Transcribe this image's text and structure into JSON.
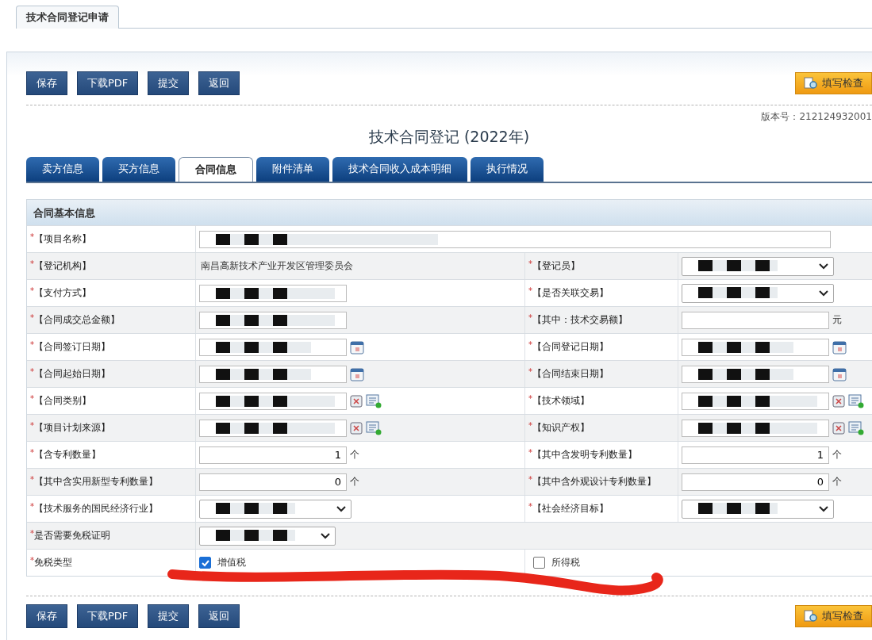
{
  "page_tab": {
    "label": "技术合同登记申请"
  },
  "toolbar": {
    "buttons": [
      "保存",
      "下载PDF",
      "提交",
      "返回"
    ],
    "check_button": "填写检查"
  },
  "bottom_toolbar": {
    "buttons": [
      "保存",
      "下载PDF",
      "提交",
      "返回"
    ],
    "check_button": "填写检查"
  },
  "version": "版本号：212124932001",
  "title": "技术合同登记 (2022年)",
  "tabs": [
    {
      "label": "卖方信息",
      "selected": false
    },
    {
      "label": "买方信息",
      "selected": false
    },
    {
      "label": "合同信息",
      "selected": true
    },
    {
      "label": "附件清单",
      "selected": false
    },
    {
      "label": "技术合同收入成本明细",
      "selected": false
    },
    {
      "label": "执行情况",
      "selected": false
    }
  ],
  "section": {
    "title": "合同基本信息",
    "rows": [
      {
        "kind": "wide",
        "fields": [
          {
            "marker": "*",
            "label": "【项目名称】",
            "kind": "input",
            "redacted": true
          }
        ]
      },
      {
        "kind": "pair",
        "fields": [
          {
            "marker": "*",
            "label": "【登记机构】",
            "kind": "text",
            "value": "南昌高新技术产业开发区管理委员会"
          },
          {
            "marker": "*",
            "label": "【登记员】",
            "kind": "select",
            "redacted": true
          }
        ]
      },
      {
        "kind": "pair",
        "fields": [
          {
            "marker": "*",
            "label": "【支付方式】",
            "kind": "input",
            "redacted": true
          },
          {
            "marker": "*",
            "label": "【是否关联交易】",
            "kind": "select",
            "redacted": true
          }
        ]
      },
      {
        "kind": "pair",
        "fields": [
          {
            "marker": "*",
            "label": "【合同成交总金额】",
            "kind": "input",
            "redacted": true
          },
          {
            "marker": "*",
            "label": "【其中：技术交易额】",
            "kind": "input",
            "unit": "元"
          }
        ]
      },
      {
        "kind": "pair",
        "fields": [
          {
            "marker": "*",
            "label": "【合同签订日期】",
            "kind": "date",
            "redacted": true
          },
          {
            "marker": "*",
            "label": "【合同登记日期】",
            "kind": "date",
            "redacted": true
          }
        ]
      },
      {
        "kind": "pair",
        "fields": [
          {
            "marker": "*",
            "label": "【合同起始日期】",
            "kind": "date",
            "redacted": true
          },
          {
            "marker": "*",
            "label": "【合同结束日期】",
            "kind": "date",
            "redacted": true
          }
        ]
      },
      {
        "kind": "pair",
        "fields": [
          {
            "marker": "*",
            "label": "【合同类别】",
            "kind": "picker",
            "redacted": true
          },
          {
            "marker": "*",
            "label": "【技术领域】",
            "kind": "picker",
            "redacted": true
          }
        ]
      },
      {
        "kind": "pair",
        "fields": [
          {
            "marker": "*",
            "label": "【项目计划来源】",
            "kind": "picker",
            "redacted": true
          },
          {
            "marker": "*",
            "label": "【知识产权】",
            "kind": "picker",
            "redacted": true
          }
        ]
      },
      {
        "kind": "pair",
        "fields": [
          {
            "marker": "*",
            "label": "【含专利数量】",
            "kind": "number",
            "value": "1",
            "unit": "个"
          },
          {
            "marker": "*",
            "label": "【其中含发明专利数量】",
            "kind": "number",
            "value": "1",
            "unit": "个"
          }
        ]
      },
      {
        "kind": "pair",
        "fields": [
          {
            "marker": "*",
            "label": "【其中含实用新型专利数量】",
            "kind": "number",
            "value": "0",
            "unit": "个"
          },
          {
            "marker": "*",
            "label": "【其中含外观设计专利数量】",
            "kind": "number",
            "value": "0",
            "unit": "个"
          }
        ]
      },
      {
        "kind": "pair",
        "fields": [
          {
            "marker": "*",
            "label": "【技术服务的国民经济行业】",
            "kind": "select",
            "redacted": true
          },
          {
            "marker": "*",
            "label": "【社会经济目标】",
            "kind": "select",
            "redacted": true
          }
        ]
      },
      {
        "kind": "wide",
        "fields": [
          {
            "marker": "*",
            "label": "是否需要免税证明",
            "kind": "short-select",
            "redacted": true
          }
        ]
      },
      {
        "kind": "checks",
        "fields": [
          {
            "marker": "*",
            "label": "免税类型",
            "kind": "checks",
            "options": [
              {
                "label": "增值税",
                "checked": true
              },
              {
                "label": "所得税",
                "checked": false
              }
            ]
          }
        ]
      }
    ]
  },
  "annotation_stroke": true
}
